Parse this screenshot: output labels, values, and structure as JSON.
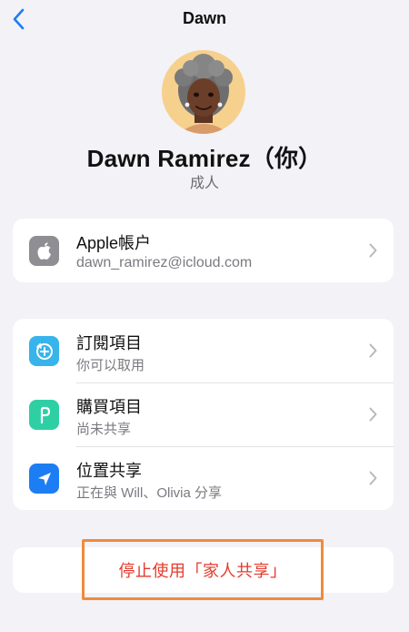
{
  "nav": {
    "title": "Dawn"
  },
  "profile": {
    "name": "Dawn Ramirez（你）",
    "role": "成人",
    "avatar_icon": "memoji-avatar-icon",
    "avatar_bg": "#f6d08d"
  },
  "account": {
    "title": "Apple帳户",
    "email": "dawn_ramirez@icloud.com",
    "icon": "apple-logo-icon"
  },
  "features": [
    {
      "title": "訂閱項目",
      "subtitle": "你可以取用",
      "icon": "subscription-icon",
      "color": "#37b4eb"
    },
    {
      "title": "購買項目",
      "subtitle": "尚未共享",
      "icon": "purchase-icon",
      "color": "#2fcfa4"
    },
    {
      "title": "位置共享",
      "subtitle": "正在與 Will、Olivia 分享",
      "icon": "location-arrow-icon",
      "color": "#1d7ef3"
    }
  ],
  "stop_sharing": {
    "label": "停止使用「家人共享」",
    "color": "#e33a2c"
  }
}
